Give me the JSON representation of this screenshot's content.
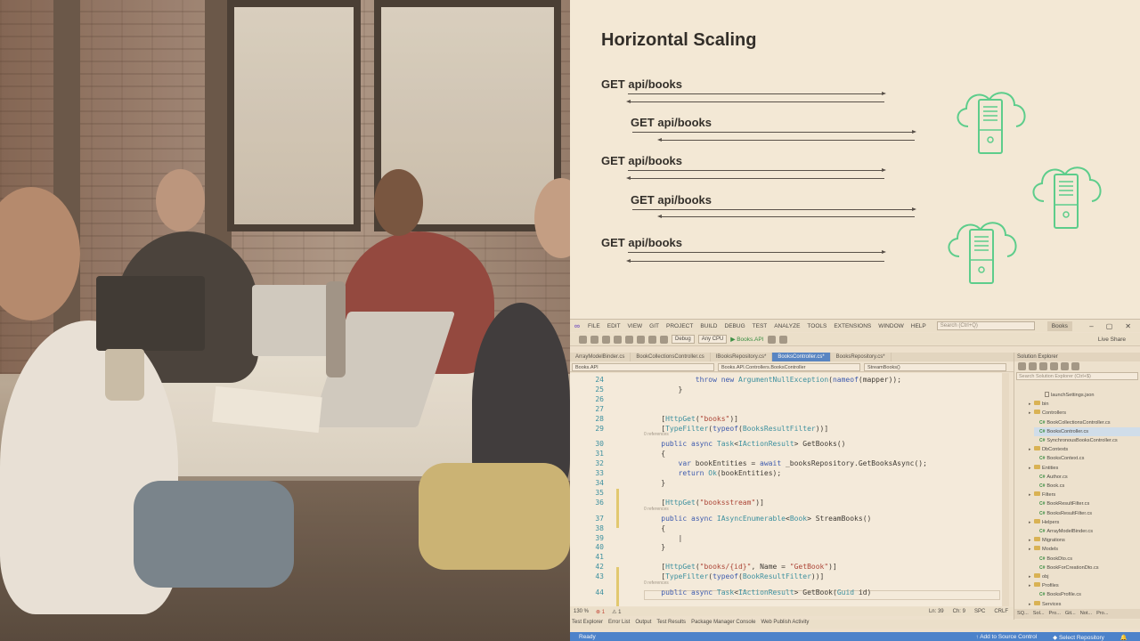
{
  "slide": {
    "title": "Horizontal Scaling",
    "requests": [
      "GET api/books",
      "GET api/books",
      "GET api/books",
      "GET api/books",
      "GET api/books"
    ],
    "accent_color": "#4fcf8a"
  },
  "vs": {
    "menu": [
      "FILE",
      "EDIT",
      "VIEW",
      "GIT",
      "PROJECT",
      "BUILD",
      "DEBUG",
      "TEST",
      "ANALYZE",
      "TOOLS",
      "EXTENSIONS",
      "WINDOW",
      "HELP"
    ],
    "search_placeholder": "Search (Ctrl+Q)",
    "solution_name": "Books",
    "toolbar": {
      "config": "Debug",
      "platform": "Any CPU",
      "run_target": "Books.API",
      "live_share": "Live Share"
    },
    "tabs": [
      {
        "label": "ArrayModelBinder.cs",
        "active": false
      },
      {
        "label": "BookCollectionsController.cs",
        "active": false
      },
      {
        "label": "IBooksRepository.cs*",
        "active": false
      },
      {
        "label": "BooksController.cs*",
        "active": true
      },
      {
        "label": "BooksRepository.cs*",
        "active": false
      }
    ],
    "nav": {
      "project": "Books.API",
      "class": "Books.API.Controllers.BooksController",
      "member": "StreamBooks()"
    },
    "code": [
      {
        "n": "24",
        "t": "            throw new ArgumentNullException(nameof(mapper));"
      },
      {
        "n": "25",
        "t": "        }"
      },
      {
        "n": "26",
        "t": ""
      },
      {
        "n": "27",
        "t": ""
      },
      {
        "n": "28",
        "t": "    [HttpGet(\"books\")]"
      },
      {
        "n": "29",
        "t": "    [TypeFilter(typeof(BooksResultFilter))]"
      },
      {
        "n": "30",
        "t": "    public async Task<IActionResult> GetBooks()"
      },
      {
        "n": "31",
        "t": "    {"
      },
      {
        "n": "32",
        "t": "        var bookEntities = await _booksRepository.GetBooksAsync();"
      },
      {
        "n": "33",
        "t": "        return Ok(bookEntities);"
      },
      {
        "n": "34",
        "t": "    }"
      },
      {
        "n": "35",
        "t": ""
      },
      {
        "n": "36",
        "t": "    [HttpGet(\"booksstream\")]"
      },
      {
        "n": "37",
        "t": "    public async IAsyncEnumerable<Book> StreamBooks()"
      },
      {
        "n": "38",
        "t": "    {"
      },
      {
        "n": "39",
        "t": "        |"
      },
      {
        "n": "40",
        "t": "    }"
      },
      {
        "n": "41",
        "t": ""
      },
      {
        "n": "42",
        "t": "    [HttpGet(\"books/{id}\", Name = \"GetBook\")]"
      },
      {
        "n": "43",
        "t": "    [TypeFilter(typeof(BookResultFilter))]"
      },
      {
        "n": "44",
        "t": "    public async Task<IActionResult> GetBook(Guid id)"
      }
    ],
    "codelens": "0 references",
    "editor_status": {
      "zoom": "130 %",
      "errors": "1",
      "warnings": "1",
      "line": "Ln: 39",
      "col": "Ch: 9",
      "spc": "SPC",
      "crlf": "CRLF"
    },
    "tool_tabs": [
      "Test Explorer",
      "Error List",
      "Output",
      "Test Results",
      "Package Manager Console",
      "Web Publish Activity"
    ],
    "status": {
      "ready": "Ready",
      "add_source": "Add to Source Control",
      "select_repo": "Select Repository"
    },
    "solution_explorer": {
      "title": "Solution Explorer",
      "search": "Search Solution Explorer (Ctrl+$)",
      "items": [
        {
          "label": "launchSettings.json",
          "kind": "file",
          "depth": 4,
          "selected": false
        },
        {
          "label": "bin",
          "kind": "folder",
          "depth": 2,
          "selected": false
        },
        {
          "label": "Controllers",
          "kind": "folder",
          "depth": 2,
          "selected": false
        },
        {
          "label": "BookCollectionsController.cs",
          "kind": "cs",
          "depth": 3,
          "selected": false
        },
        {
          "label": "BooksController.cs",
          "kind": "cs",
          "depth": 3,
          "selected": true
        },
        {
          "label": "SynchronousBooksController.cs",
          "kind": "cs",
          "depth": 3,
          "selected": false
        },
        {
          "label": "DbContexts",
          "kind": "folder",
          "depth": 2,
          "selected": false
        },
        {
          "label": "BooksContext.cs",
          "kind": "cs",
          "depth": 3,
          "selected": false
        },
        {
          "label": "Entities",
          "kind": "folder",
          "depth": 2,
          "selected": false
        },
        {
          "label": "Author.cs",
          "kind": "cs",
          "depth": 3,
          "selected": false
        },
        {
          "label": "Book.cs",
          "kind": "cs",
          "depth": 3,
          "selected": false
        },
        {
          "label": "Filters",
          "kind": "folder",
          "depth": 2,
          "selected": false
        },
        {
          "label": "BookResultFilter.cs",
          "kind": "cs",
          "depth": 3,
          "selected": false
        },
        {
          "label": "BooksResultFilter.cs",
          "kind": "cs",
          "depth": 3,
          "selected": false
        },
        {
          "label": "Helpers",
          "kind": "folder",
          "depth": 2,
          "selected": false
        },
        {
          "label": "ArrayModelBinder.cs",
          "kind": "cs",
          "depth": 3,
          "selected": false
        },
        {
          "label": "Migrations",
          "kind": "folder",
          "depth": 2,
          "selected": false
        },
        {
          "label": "Models",
          "kind": "folder",
          "depth": 2,
          "selected": false
        },
        {
          "label": "BookDto.cs",
          "kind": "cs",
          "depth": 3,
          "selected": false
        },
        {
          "label": "BookForCreationDto.cs",
          "kind": "cs",
          "depth": 3,
          "selected": false
        },
        {
          "label": "obj",
          "kind": "folder",
          "depth": 2,
          "selected": false
        },
        {
          "label": "Profiles",
          "kind": "folder",
          "depth": 2,
          "selected": false
        },
        {
          "label": "BooksProfile.cs",
          "kind": "cs",
          "depth": 3,
          "selected": false
        },
        {
          "label": "Services",
          "kind": "folder",
          "depth": 2,
          "selected": false
        }
      ],
      "bottom_tabs": [
        "SQ...",
        "Sol...",
        "Pro...",
        "Git...",
        "Not...",
        "Pro..."
      ]
    }
  }
}
